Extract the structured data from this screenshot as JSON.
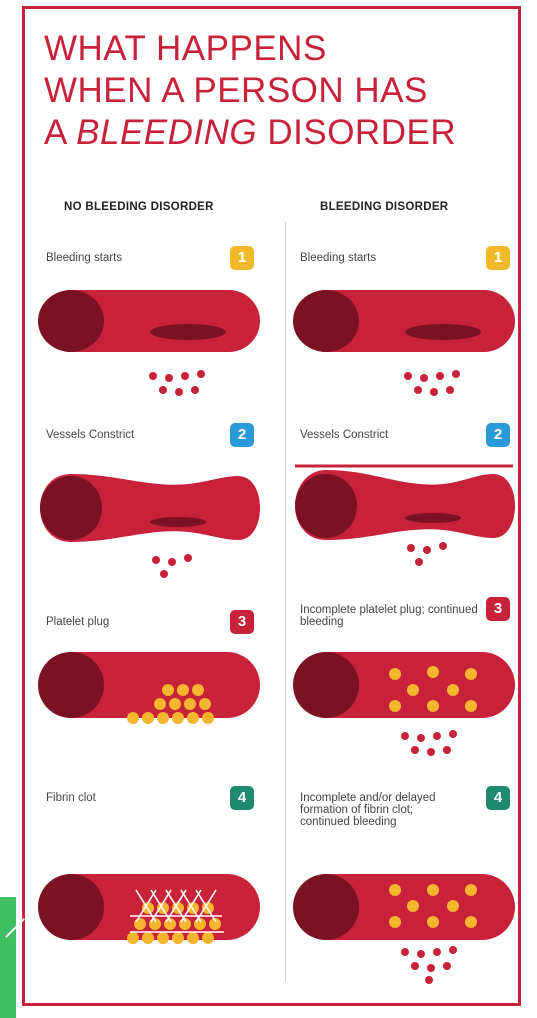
{
  "title": {
    "line1": "WHAT HAPPENS",
    "line2": "WHEN A PERSON HAS",
    "line3_prefix": "A ",
    "line3_emphasis": "BLEEDING",
    "line3_suffix": " DISORDER"
  },
  "columns": {
    "left_heading": "NO BLEEDING DISORDER",
    "right_heading": "BLEEDING DISORDER"
  },
  "steps": [
    {
      "number": "1",
      "icon": "step-1-icon",
      "color": "#f1b82a",
      "left_label": "Bleeding starts",
      "right_label": "Bleeding starts"
    },
    {
      "number": "2",
      "icon": "step-2-icon",
      "color": "#2c9ad8",
      "left_label": "Vessels Constrict",
      "right_label": "Vessels Constrict"
    },
    {
      "number": "3",
      "icon": "step-3-icon",
      "color": "#c8213a",
      "left_label": "Platelet plug",
      "right_label": "Incomplete platelet plug; continued bleeding"
    },
    {
      "number": "4",
      "icon": "step-4-icon",
      "color": "#1f8a6e",
      "left_label": "Fibrin clot",
      "right_label": "Incomplete and/or delayed formation of fibrin clot; continued bleeding"
    }
  ],
  "colors": {
    "vessel": "#c8213a",
    "vessel_dark": "#7a1224",
    "platelet": "#f5b52e",
    "fibrin": "#ffffff"
  }
}
